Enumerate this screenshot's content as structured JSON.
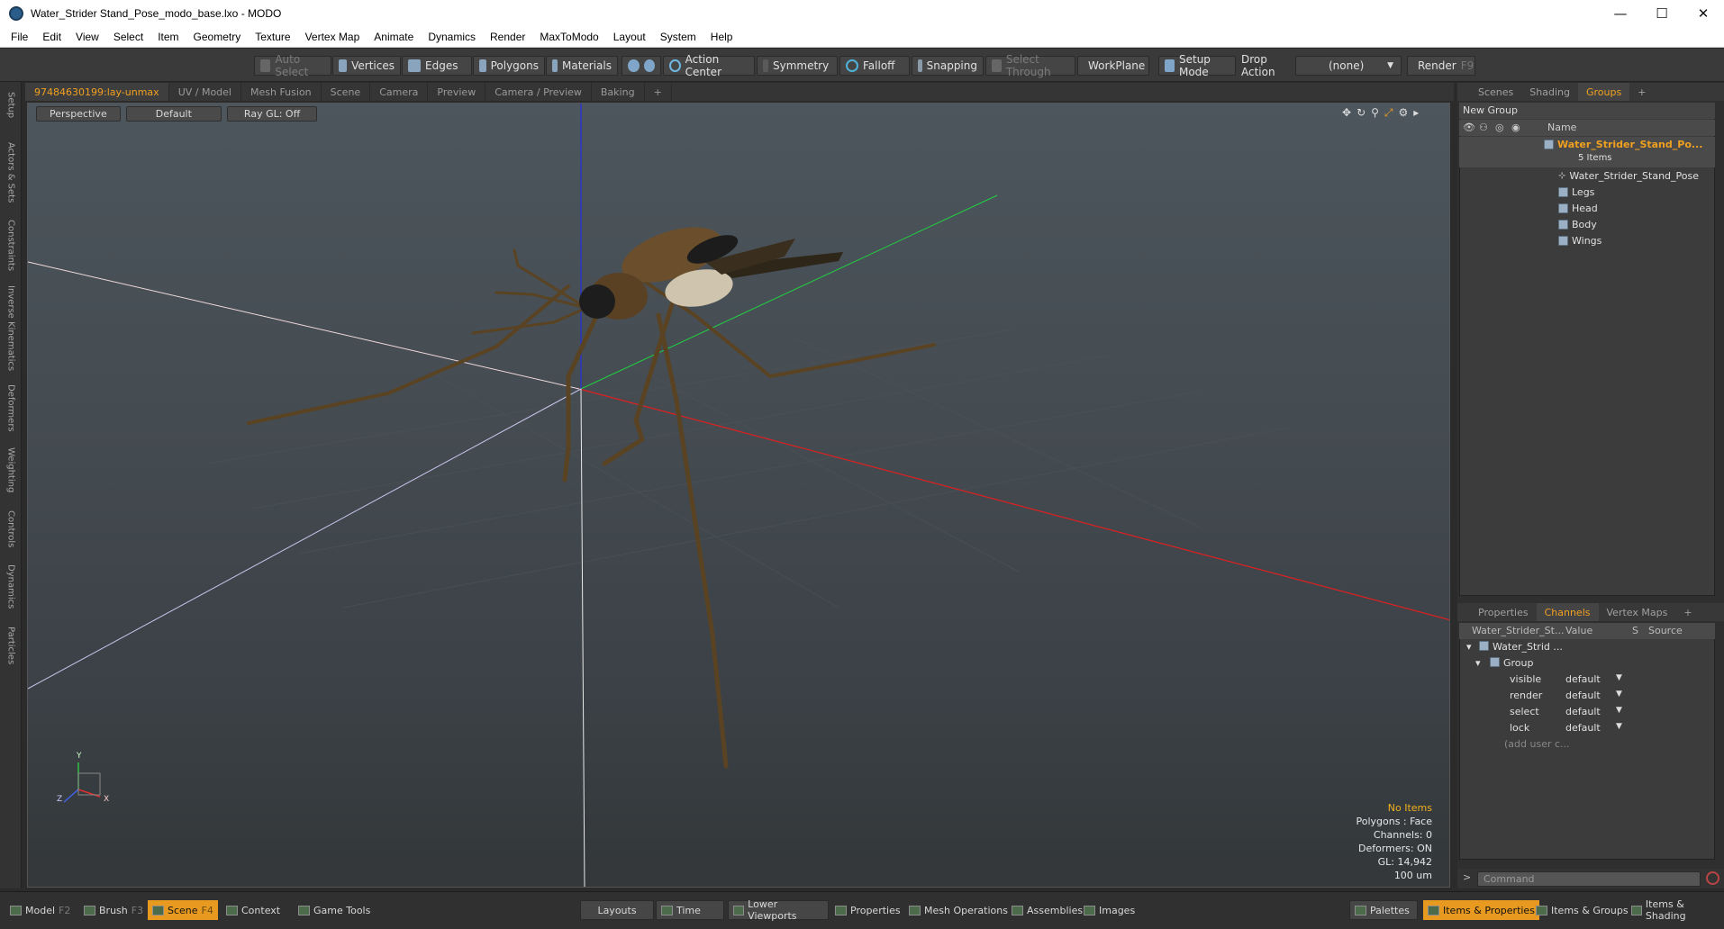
{
  "window": {
    "title": "Water_Strider Stand_Pose_modo_base.lxo - MODO",
    "minimize": "—",
    "maximize": "☐",
    "close": "✕"
  },
  "menu": [
    "File",
    "Edit",
    "View",
    "Select",
    "Item",
    "Geometry",
    "Texture",
    "Vertex Map",
    "Animate",
    "Dynamics",
    "Render",
    "MaxToModo",
    "Layout",
    "System",
    "Help"
  ],
  "toolbar": {
    "auto_select": "Auto Select",
    "vertices": "Vertices",
    "edges": "Edges",
    "polygons": "Polygons",
    "materials": "Materials",
    "action_center": "Action Center",
    "symmetry": "Symmetry",
    "falloff": "Falloff",
    "snapping": "Snapping",
    "select_through": "Select Through",
    "workplane": "WorkPlane",
    "setup_mode": "Setup Mode",
    "drop_action": "Drop Action",
    "drop_value": "(none)",
    "render": "Render",
    "render_key": "F9"
  },
  "left_tabs": [
    "Setup",
    "Actors & Sets",
    "Constraints",
    "Inverse Kinematics",
    "Deformers",
    "Weighting",
    "Controls",
    "Dynamics",
    "Particles"
  ],
  "viewport_tabs": [
    "97484630199:lay-unmax",
    "UV / Model",
    "Mesh Fusion",
    "Scene",
    "Camera",
    "Preview",
    "Camera / Preview",
    "Baking",
    "+"
  ],
  "viewport": {
    "perspective": "Perspective",
    "default": "Default",
    "raygl": "Ray GL: Off",
    "hud": [
      "No Items",
      "Polygons : Face",
      "Channels: 0",
      "Deformers: ON",
      "GL: 14,942",
      "100 um"
    ],
    "axis_x": "X",
    "axis_y": "Y",
    "axis_z": "Z"
  },
  "right_tabs_top": [
    "Scenes",
    "Shading",
    "Groups",
    "+"
  ],
  "groups": {
    "new_group": "New Group",
    "name_header": "Name",
    "root": "Water_Strider_Stand_Po...",
    "root_count": "5 Items",
    "children": [
      "Water_Strider_Stand_Pose",
      "Legs",
      "Head",
      "Body",
      "Wings"
    ]
  },
  "right_tabs_bottom": [
    "Properties",
    "Channels",
    "Vertex Maps",
    "+"
  ],
  "channels": {
    "headers": [
      "Water_Strider_St...",
      "Value",
      "S",
      "Source"
    ],
    "item": "Water_Strid ...",
    "group": "Group",
    "rows": [
      {
        "name": "visible",
        "value": "default"
      },
      {
        "name": "render",
        "value": "default"
      },
      {
        "name": "select",
        "value": "default"
      },
      {
        "name": "lock",
        "value": "default"
      }
    ],
    "add_user": "(add user c..."
  },
  "command": {
    "prompt": ">",
    "placeholder": "Command"
  },
  "bottom": {
    "model": "Model",
    "model_key": "F2",
    "brush": "Brush",
    "brush_key": "F3",
    "scene": "Scene",
    "scene_key": "F4",
    "context": "Context",
    "game_tools": "Game Tools",
    "layouts": "Layouts",
    "time": "Time",
    "lower_viewports": "Lower Viewports",
    "properties": "Properties",
    "mesh_operations": "Mesh Operations",
    "assemblies": "Assemblies",
    "images": "Images",
    "palettes": "Palettes",
    "items_properties": "Items & Properties",
    "items_groups": "Items & Groups",
    "items_shading": "Items & Shading"
  }
}
